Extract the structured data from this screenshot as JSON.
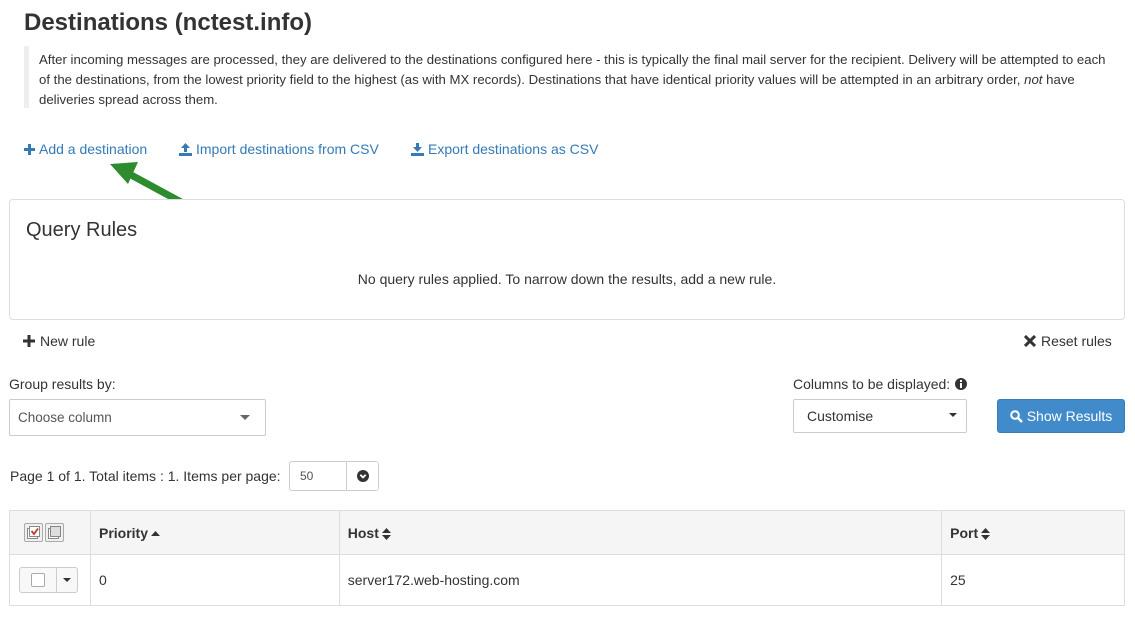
{
  "page": {
    "title": "Destinations (nctest.info)",
    "description_1": "After incoming messages are processed, they are delivered to the destinations configured here - this is typically the final mail server for the recipient. Delivery will be attempted to each of the destinations, from the lowest priority field to the highest (as with MX records). Destinations that have identical priority values will be attempted in an arbitrary order, ",
    "description_em": "not",
    "description_2": " have deliveries spread across them."
  },
  "actions": {
    "add": "Add a destination",
    "import": "Import destinations from CSV",
    "export": "Export destinations as CSV"
  },
  "query_rules": {
    "title": "Query Rules",
    "empty": "No query rules applied. To narrow down the results, add a new rule.",
    "new_rule": "New rule",
    "reset_rules": "Reset rules"
  },
  "controls": {
    "group_label": "Group results by:",
    "group_placeholder": "Choose column",
    "columns_label": "Columns to be displayed:",
    "columns_value": "Customise",
    "show_results": "Show Results"
  },
  "pager": {
    "text": "Page 1 of 1. Total items : 1. Items per page:",
    "per_page": "50"
  },
  "table": {
    "headers": {
      "priority": "Priority",
      "host": "Host",
      "port": "Port"
    },
    "rows": [
      {
        "priority": "0",
        "host": "server172.web-hosting.com",
        "port": "25"
      }
    ]
  },
  "colors": {
    "link": "#337ab7",
    "primary_button": "#428bca",
    "arrow": "#2e8b2e"
  },
  "icons": {
    "add": "plus-icon",
    "import": "upload-icon",
    "export": "download-icon",
    "new_rule": "plus-icon",
    "reset": "times-icon",
    "info": "info-circle-icon",
    "search": "search-icon",
    "go": "chevron-circle-icon"
  }
}
